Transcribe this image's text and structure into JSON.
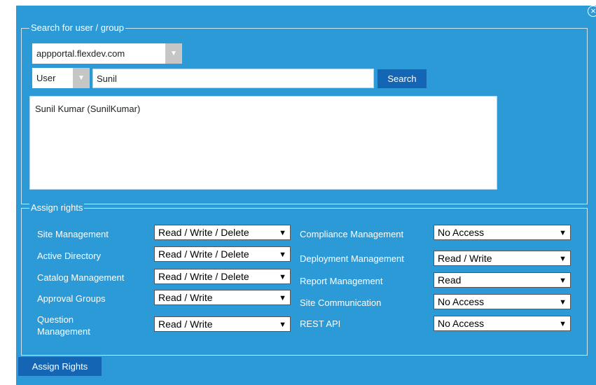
{
  "search_section": {
    "legend": "Search for user / group",
    "domain_value": "appportal.flexdev.com",
    "type_value": "User",
    "query_value": "Sunil",
    "search_label": "Search",
    "results": [
      "Sunil Kumar (SunilKumar)"
    ]
  },
  "rights_section": {
    "legend": "Assign rights",
    "rights": [
      {
        "label": "Site Management",
        "value": "Read / Write / Delete"
      },
      {
        "label": "Active Directory",
        "value": "Read / Write / Delete"
      },
      {
        "label": "Catalog Management",
        "value": "Read / Write / Delete"
      },
      {
        "label": "Approval Groups",
        "value": "Read / Write"
      },
      {
        "label": "Question Management",
        "value": "Read / Write"
      },
      {
        "label": "Compliance Management",
        "value": "No Access"
      },
      {
        "label": "Deployment Management",
        "value": "Read / Write"
      },
      {
        "label": "Report Management",
        "value": "Read"
      },
      {
        "label": "Site Communication",
        "value": "No Access"
      },
      {
        "label": "REST API",
        "value": "No Access"
      }
    ]
  },
  "assign_button_label": "Assign Rights",
  "close_symbol": "×",
  "icons": {
    "dropdown_arrow": "▼",
    "select_arrow": "▼"
  },
  "colors": {
    "dialog_bg": "#2b9ad7",
    "button_bg": "#1466b5"
  }
}
